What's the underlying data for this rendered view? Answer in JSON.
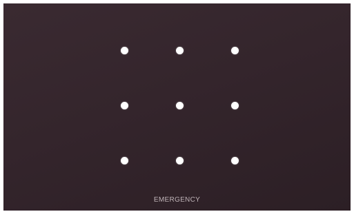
{
  "lock_screen": {
    "pattern_grid": {
      "rows": 3,
      "columns": 3
    },
    "emergency_label": "EMERGENCY"
  },
  "colors": {
    "background": "#342329",
    "dot": "#ffffff",
    "emergency_text": "#bfb4b8"
  }
}
